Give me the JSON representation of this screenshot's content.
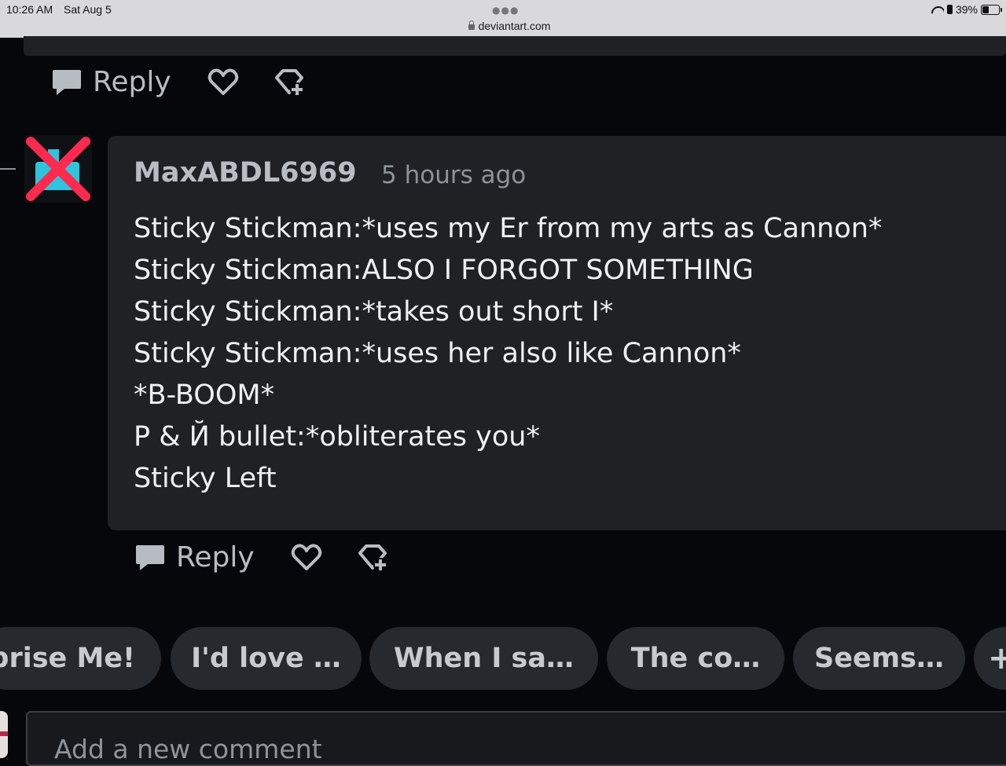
{
  "status_bar": {
    "time": "10:26 AM",
    "date": "Sat Aug 5",
    "url": "deviantart.com",
    "battery": "39%"
  },
  "prev_comment": {
    "reply_label": "Reply"
  },
  "comment": {
    "username": "MaxABDL6969",
    "timestamp": "5 hours ago",
    "lines": [
      "Sticky Stickman:*uses my Er from my arts as Cannon*",
      "Sticky Stickman:ALSO I FORGOT SOMETHING",
      "Sticky Stickman:*takes out short I*",
      "Sticky Stickman:*uses her also like Cannon*",
      "*B-BOOM*",
      "P & Й bullet:*obliterates you*",
      "Sticky Left"
    ],
    "reply_label": "Reply"
  },
  "suggestions": [
    "rprise Me!",
    "I'd love …",
    "When I sa…",
    "The co…",
    "Seems…",
    "+"
  ],
  "new_comment": {
    "placeholder": "Add a new comment"
  },
  "colors": {
    "background": "#06070a",
    "card": "#1f2125",
    "chip": "#26292d",
    "avatar_cross": "#ff2a4d",
    "avatar_glyph": "#2fc4dd"
  },
  "icons": [
    "lock-icon",
    "wifi-icon",
    "battery-icon",
    "speech-bubble-icon",
    "heart-icon",
    "award-icon",
    "plus-icon"
  ]
}
